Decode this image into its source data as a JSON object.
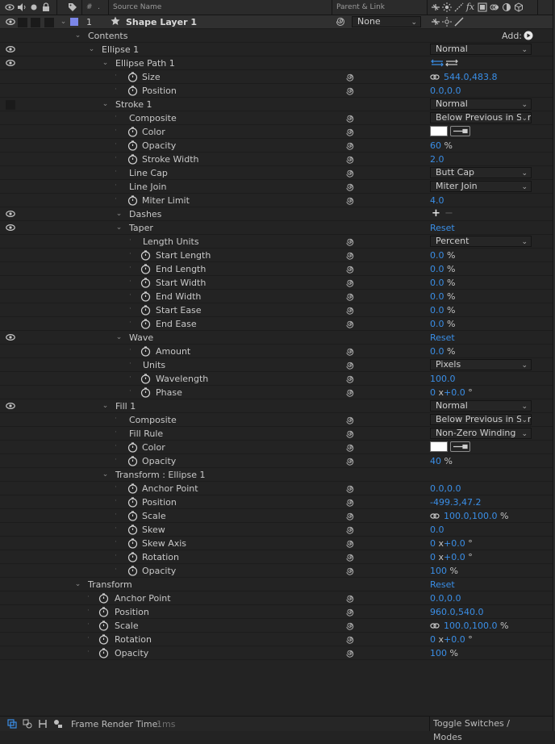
{
  "header": {
    "hash": "#",
    "source_name": "Source Name",
    "parent_link": "Parent & Link",
    "fx": "fx"
  },
  "layer": {
    "number": "1",
    "name": "Shape Layer 1",
    "parent_value": "None",
    "label_color": "#7b86e8"
  },
  "rows": [
    {
      "name": "Contents",
      "add": "Add:"
    },
    {
      "name": "Ellipse 1",
      "dropdown": "Normal"
    },
    {
      "name": "Ellipse Path 1"
    },
    {
      "name": "Size",
      "value": "544.0,483.8"
    },
    {
      "name": "Position",
      "value": "0.0,0.0"
    },
    {
      "name": "Stroke 1",
      "dropdown": "Normal"
    },
    {
      "name": "Composite",
      "dropdown": "Below Previous in Same Group"
    },
    {
      "name": "Color"
    },
    {
      "name": "Opacity",
      "value": "60",
      "unit": "%"
    },
    {
      "name": "Stroke Width",
      "value": "2.0"
    },
    {
      "name": "Line Cap",
      "dropdown": "Butt Cap"
    },
    {
      "name": "Line Join",
      "dropdown": "Miter Join"
    },
    {
      "name": "Miter Limit",
      "value": "4.0"
    },
    {
      "name": "Dashes"
    },
    {
      "name": "Taper",
      "reset": "Reset"
    },
    {
      "name": "Length Units",
      "dropdown": "Percent"
    },
    {
      "name": "Start Length",
      "value": "0.0",
      "unit": "%"
    },
    {
      "name": "End Length",
      "value": "0.0",
      "unit": "%"
    },
    {
      "name": "Start Width",
      "value": "0.0",
      "unit": "%"
    },
    {
      "name": "End Width",
      "value": "0.0",
      "unit": "%"
    },
    {
      "name": "Start Ease",
      "value": "0.0",
      "unit": "%"
    },
    {
      "name": "End Ease",
      "value": "0.0",
      "unit": "%"
    },
    {
      "name": "Wave",
      "reset": "Reset"
    },
    {
      "name": "Amount",
      "value": "0.0",
      "unit": "%"
    },
    {
      "name": "Units",
      "dropdown": "Pixels"
    },
    {
      "name": "Wavelength",
      "value": "100.0"
    },
    {
      "name": "Phase",
      "value": "0",
      "unit": "x",
      "value2": "+0.0",
      "unit2": "°"
    },
    {
      "name": "Fill 1",
      "dropdown": "Normal"
    },
    {
      "name": "Composite",
      "dropdown": "Below Previous in Same Group"
    },
    {
      "name": "Fill Rule",
      "dropdown": "Non-Zero Winding"
    },
    {
      "name": "Color"
    },
    {
      "name": "Opacity",
      "value": "40",
      "unit": "%"
    },
    {
      "name": "Transform : Ellipse 1"
    },
    {
      "name": "Anchor Point",
      "value": "0.0,0.0"
    },
    {
      "name": "Position",
      "value": "-499.3,47.2"
    },
    {
      "name": "Scale",
      "value": "100.0,100.0",
      "unit": "%"
    },
    {
      "name": "Skew",
      "value": "0.0"
    },
    {
      "name": "Skew Axis",
      "value": "0",
      "unit": "x",
      "value2": "+0.0",
      "unit2": "°"
    },
    {
      "name": "Rotation",
      "value": "0",
      "unit": "x",
      "value2": "+0.0",
      "unit2": "°"
    },
    {
      "name": "Opacity",
      "value": "100",
      "unit": "%"
    },
    {
      "name": "Transform",
      "reset": "Reset"
    },
    {
      "name": "Anchor Point",
      "value": "0.0,0.0"
    },
    {
      "name": "Position",
      "value": "960.0,540.0"
    },
    {
      "name": "Scale",
      "value": "100.0,100.0",
      "unit": "%"
    },
    {
      "name": "Rotation",
      "value": "0",
      "unit": "x",
      "value2": "+0.0",
      "unit2": "°"
    },
    {
      "name": "Opacity",
      "value": "100",
      "unit": "%"
    }
  ],
  "footer": {
    "frame_render_label": "Frame Render Time:",
    "frame_render_value": "1ms",
    "toggle_label": "Toggle Switches / Modes"
  },
  "colors": {
    "value_blue": "#3a8ee6",
    "panel_bg": "#232323",
    "swatch_white": "#ffffff"
  }
}
